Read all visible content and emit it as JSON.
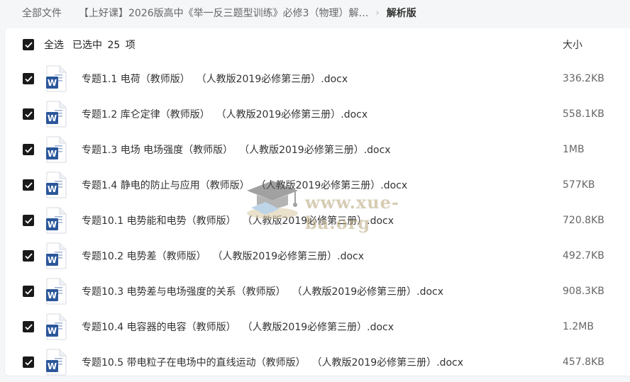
{
  "breadcrumb": {
    "root": "全部文件",
    "folder": "【上好课】2026版高中《举一反三题型训练》必修3（物理）解…",
    "current": "解析版",
    "separator": "›"
  },
  "list_header": {
    "select_all_label": "全选",
    "selected_info": "已选中 25 项",
    "size_column": "大小"
  },
  "files": [
    {
      "name": "专题1.1 电荷（教师版）  （人教版2019必修第三册）.docx",
      "size": "336.2KB"
    },
    {
      "name": "专题1.2 库仑定律（教师版）  （人教版2019必修第三册）.docx",
      "size": "558.1KB"
    },
    {
      "name": "专题1.3 电场 电场强度（教师版）  （人教版2019必修第三册）.docx",
      "size": "1MB"
    },
    {
      "name": "专题1.4 静电的防止与应用（教师版）  （人教版2019必修第三册）.docx",
      "size": "577KB"
    },
    {
      "name": "专题10.1 电势能和电势（教师版）  （人教版2019必修第三册）.docx",
      "size": "720.8KB"
    },
    {
      "name": "专题10.2 电势差（教师版）  （人教版2019必修第三册）.docx",
      "size": "492.7KB"
    },
    {
      "name": "专题10.3 电势差与电场强度的关系（教师版）  （人教版2019必修第三册）.docx",
      "size": "908.3KB"
    },
    {
      "name": "专题10.4 电容器的电容（教师版）  （人教版2019必修第三册）.docx",
      "size": "1.2MB"
    },
    {
      "name": "专题10.5 带电粒子在电场中的直线运动（教师版）  （人教版2019必修第三册）.docx",
      "size": "457.8KB"
    }
  ],
  "watermark": {
    "text": "www.xue-ba.org",
    "icon": "graduation-cap-icon"
  },
  "icons": {
    "file": "word-doc-icon",
    "checkbox": "checkbox-checked-icon"
  },
  "colors": {
    "word_blue": "#2b579a",
    "checkbox": "#1a1a1a",
    "background": "#f5f6f8"
  }
}
